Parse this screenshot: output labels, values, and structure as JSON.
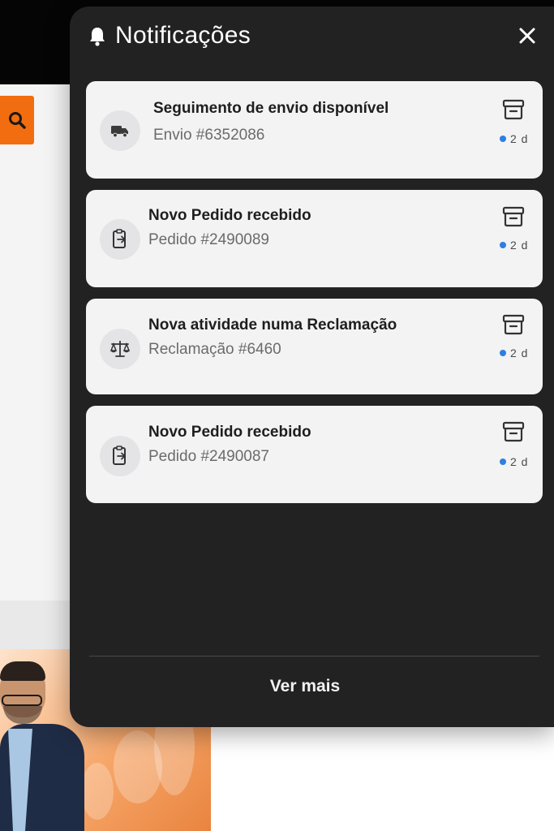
{
  "panel": {
    "title": "Notificações",
    "more_label": "Ver mais"
  },
  "notifications": [
    {
      "title": "Seguimento de envio disponível",
      "subtitle": "Envio #6352086",
      "time": "2 d",
      "icon": "truck-icon"
    },
    {
      "title": "Novo Pedido recebido",
      "subtitle": "Pedido #2490089",
      "time": "2 d",
      "icon": "order-icon"
    },
    {
      "title": "Nova atividade numa Reclamação",
      "subtitle": "Reclamação #6460",
      "time": "2 d",
      "icon": "scales-icon"
    },
    {
      "title": "Novo Pedido recebido",
      "subtitle": "Pedido #2490087",
      "time": "2 d",
      "icon": "order-icon"
    }
  ],
  "colors": {
    "panel_bg": "#232223",
    "card_bg": "#f3f3f4",
    "accent_orange": "#f26d0f",
    "unread_dot": "#2d7fe0"
  }
}
